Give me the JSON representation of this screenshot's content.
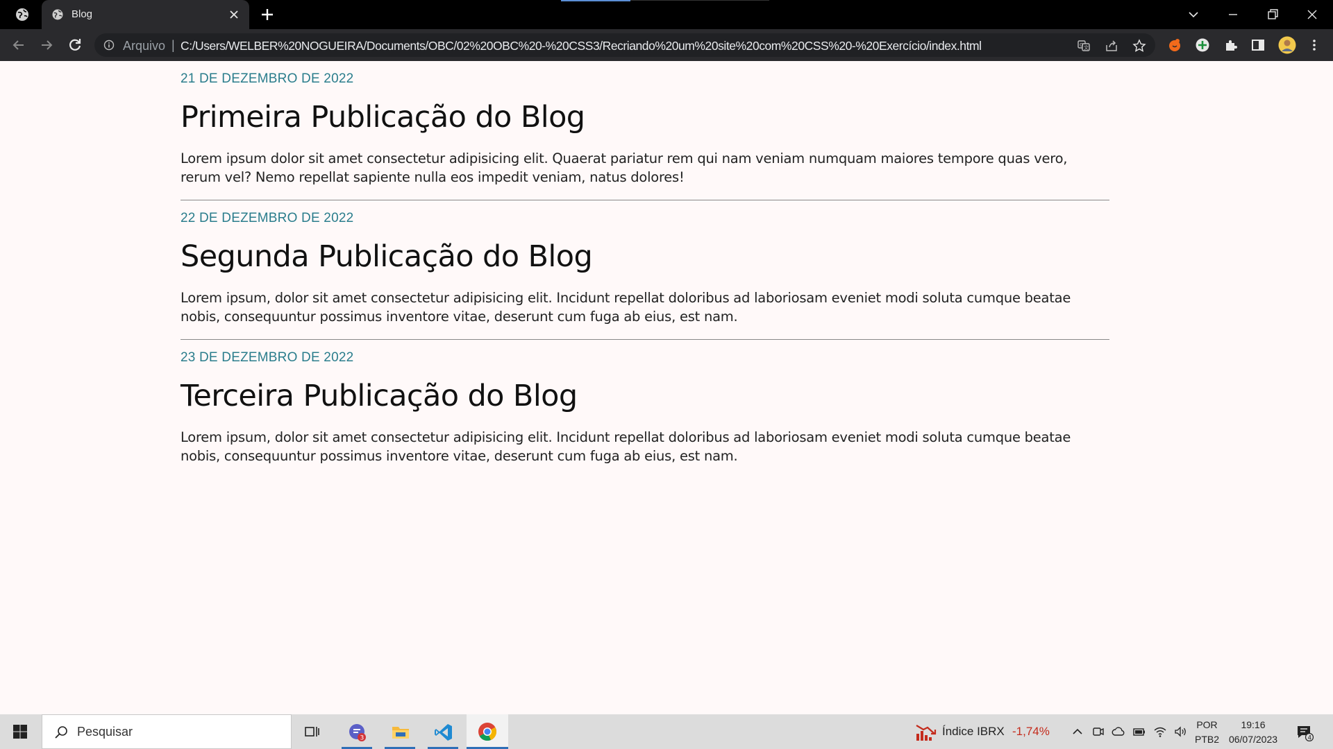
{
  "browser": {
    "tab": {
      "title": "Blog"
    },
    "address": {
      "scheme_label": "Arquivo",
      "separator": "|",
      "url": "C:/Users/WELBER%20NOGUEIRA/Documents/OBC/02%20OBC%20-%20CSS3/Recriando%20um%20site%20com%20CSS%20-%20Exercício/index.html"
    }
  },
  "posts": [
    {
      "date": "21 DE DEZEMBRO DE 2022",
      "title": "Primeira Publicação do Blog",
      "body": "Lorem ipsum dolor sit amet consectetur adipisicing elit. Quaerat pariatur rem qui nam veniam numquam maiores tempore quas vero, rerum vel? Nemo repellat sapiente nulla eos impedit veniam, natus dolores!"
    },
    {
      "date": "22 DE DEZEMBRO DE 2022",
      "title": "Segunda Publicação do Blog",
      "body": "Lorem ipsum, dolor sit amet consectetur adipisicing elit. Incidunt repellat doloribus ad laboriosam eveniet modi soluta cumque beatae nobis, consequuntur possimus inventore vitae, deserunt cum fuga ab eius, est nam."
    },
    {
      "date": "23 DE DEZEMBRO DE 2022",
      "title": "Terceira Publicação do Blog",
      "body": "Lorem ipsum, dolor sit amet consectetur adipisicing elit. Incidunt repellat doloribus ad laboriosam eveniet modi soluta cumque beatae nobis, consequuntur possimus inventore vitae, deserunt cum fuga ab eius, est nam."
    }
  ],
  "taskbar": {
    "search_placeholder": "Pesquisar",
    "chat_badge": "3",
    "stock": {
      "name": "Índice IBRX",
      "change": "-1,74%"
    },
    "language": {
      "line1": "POR",
      "line2": "PTB2"
    },
    "clock": {
      "time": "19:16",
      "date": "06/07/2023"
    },
    "notification_count": "4"
  },
  "colors": {
    "date_accent": "#2a7d8c",
    "page_background": "#fff9f9",
    "stock_negative": "#c42b1c"
  }
}
